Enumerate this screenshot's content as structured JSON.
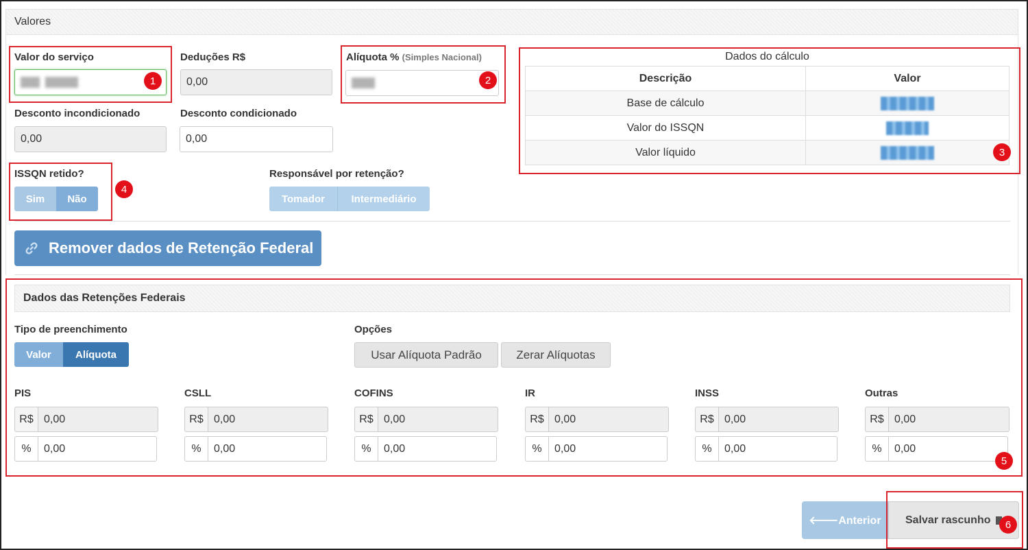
{
  "valores_panel": {
    "title": "Valores"
  },
  "valor_servico": {
    "label": "Valor do serviço",
    "marker": "1"
  },
  "deducoes": {
    "label": "Deduções R$",
    "value": "0,00"
  },
  "aliquota": {
    "label": "Alíquota %",
    "sublabel": "(Simples Nacional)",
    "marker": "2"
  },
  "desconto_incondicionado": {
    "label": "Desconto incondicionado",
    "value": "0,00"
  },
  "desconto_condicionado": {
    "label": "Desconto condicionado",
    "value": "0,00"
  },
  "calculo": {
    "title": "Dados do cálculo",
    "col_descricao": "Descrição",
    "col_valor": "Valor",
    "rows": [
      "Base de cálculo",
      "Valor do ISSQN",
      "Valor líquido"
    ],
    "marker": "3"
  },
  "issqn_retido": {
    "label": "ISSQN retido?",
    "sim": "Sim",
    "nao": "Não",
    "marker": "4"
  },
  "responsavel": {
    "label": "Responsável por retenção?",
    "tomador": "Tomador",
    "intermediario": "Intermediário"
  },
  "remover_button": {
    "label": "Remover dados de Retenção Federal",
    "icon": "link-icon"
  },
  "retencoes": {
    "title": "Dados das Retenções Federais",
    "tipo_label": "Tipo de preenchimento",
    "tipo_valor": "Valor",
    "tipo_aliquota": "Alíquota",
    "opcoes_label": "Opções",
    "usar_padrao": "Usar Alíquota Padrão",
    "zerar": "Zerar Alíquotas",
    "currency_addon": "R$",
    "percent_addon": "%",
    "taxes": [
      {
        "name": "PIS",
        "valor": "0,00",
        "aliquota": "0,00"
      },
      {
        "name": "CSLL",
        "valor": "0,00",
        "aliquota": "0,00"
      },
      {
        "name": "COFINS",
        "valor": "0,00",
        "aliquota": "0,00"
      },
      {
        "name": "IR",
        "valor": "0,00",
        "aliquota": "0,00"
      },
      {
        "name": "INSS",
        "valor": "0,00",
        "aliquota": "0,00"
      },
      {
        "name": "Outras",
        "valor": "0,00",
        "aliquota": "0,00"
      }
    ],
    "marker": "5"
  },
  "footer": {
    "anterior": "🡐Anterior",
    "salvar": "Salvar rascunho",
    "marker": "6"
  },
  "colors": {
    "accent": "#428bca",
    "highlight": "#d9232d",
    "marker": "#e3101a",
    "disabled_blue": "#a8c8e4"
  }
}
